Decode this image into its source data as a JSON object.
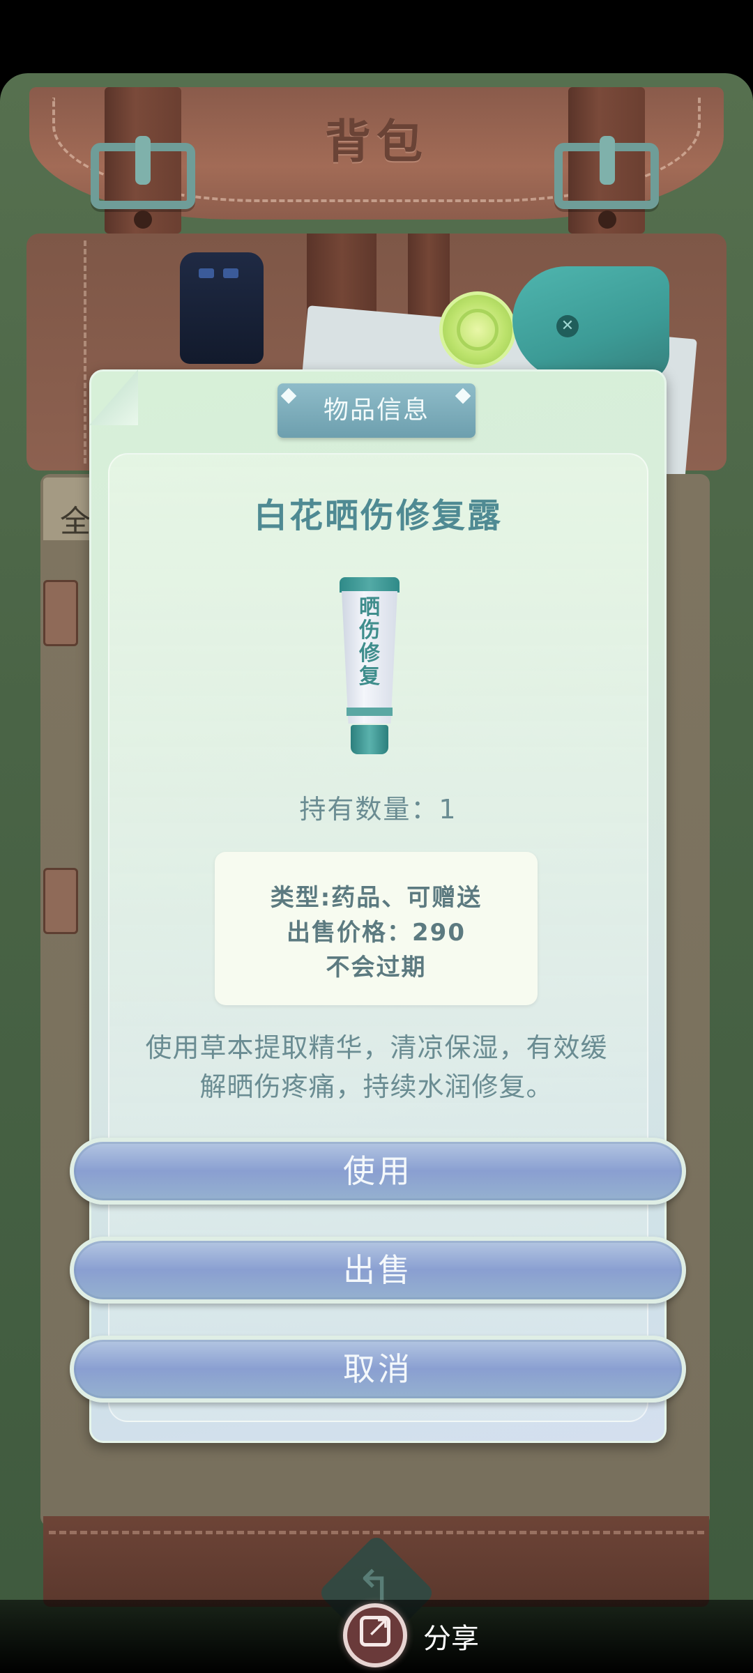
{
  "backpack": {
    "title": "背包",
    "tab_label": "全"
  },
  "dialog": {
    "header": "物品信息",
    "item_name": "白花晒伤修复露",
    "icon_text": "晒伤修复",
    "quantity": "持有数量：1",
    "info": {
      "type": "类型:药品、可赠送",
      "price": "出售价格：290",
      "expiry": "不会过期"
    },
    "description": "使用草本提取精华，清凉保湿，有效缓解晒伤疼痛，持续水润修复。",
    "buttons": {
      "use": "使用",
      "sell": "出售",
      "cancel": "取消"
    }
  },
  "share": {
    "label": "分享"
  },
  "icons": [
    "back-icon",
    "share-icon",
    "sunburn-cream-tube-icon"
  ],
  "colors": {
    "title_teal": "#4f8a93",
    "button_lavender": "#8a9fd1",
    "backpack_brown": "#8a5b4b"
  }
}
